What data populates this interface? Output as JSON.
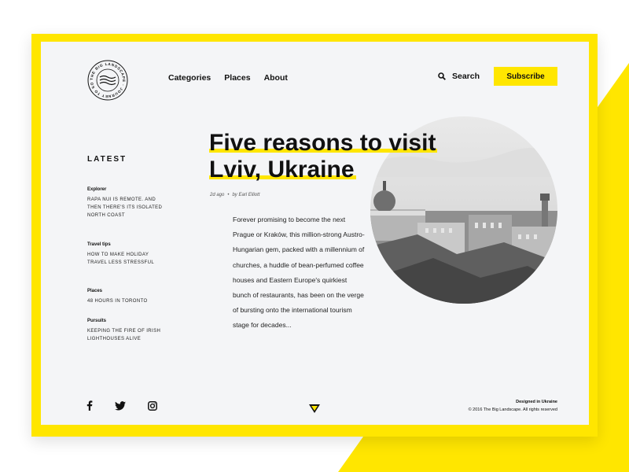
{
  "colors": {
    "accent": "#ffe600",
    "background": "#f4f5f7",
    "text": "#111111"
  },
  "brand": {
    "logo_ring_text": "THE BIG LANDSCAPE · JOURNEY TO SOMEWHERE ·"
  },
  "nav": {
    "items": [
      {
        "label": "Categories"
      },
      {
        "label": "Places"
      },
      {
        "label": "About"
      }
    ]
  },
  "header": {
    "search_label": "Search",
    "subscribe_label": "Subscribe"
  },
  "sidebar": {
    "title": "LATEST",
    "items": [
      {
        "category": "Explorer",
        "text": "RAPA NUI IS REMOTE. AND THEN THERE'S ITS ISOLATED NORTH COAST"
      },
      {
        "category": "Travel tips",
        "text": "HOW TO MAKE HOLIDAY TRAVEL LESS STRESSFUL"
      },
      {
        "category": "Places",
        "text": "48 HOURS IN TORONTO"
      },
      {
        "category": "Pursuits",
        "text": "KEEPING THE FIRE OF IRISH LIGHTHOUSES ALIVE"
      }
    ]
  },
  "article": {
    "title_line1": "Five reasons to visit",
    "title_line2": "Lviv, Ukraine",
    "time_ago": "2d ago",
    "separator": "•",
    "author": "by Earl Elliott",
    "excerpt": "Forever promising to become the next Prague or Kraków, this million-strong Austro-Hungarian gem, packed with a millennium of churches, a huddle of bean-perfumed coffee houses and Eastern Europe's quirkiest bunch of restaurants, has been on the verge of bursting onto the international tourism stage for decades..."
  },
  "social": {
    "icons": [
      "facebook-icon",
      "twitter-icon",
      "instagram-icon"
    ]
  },
  "footer": {
    "designed_in": "Designed in Ukraine",
    "copyright": "© 2016 The Big Landscape. All rights reserved"
  }
}
